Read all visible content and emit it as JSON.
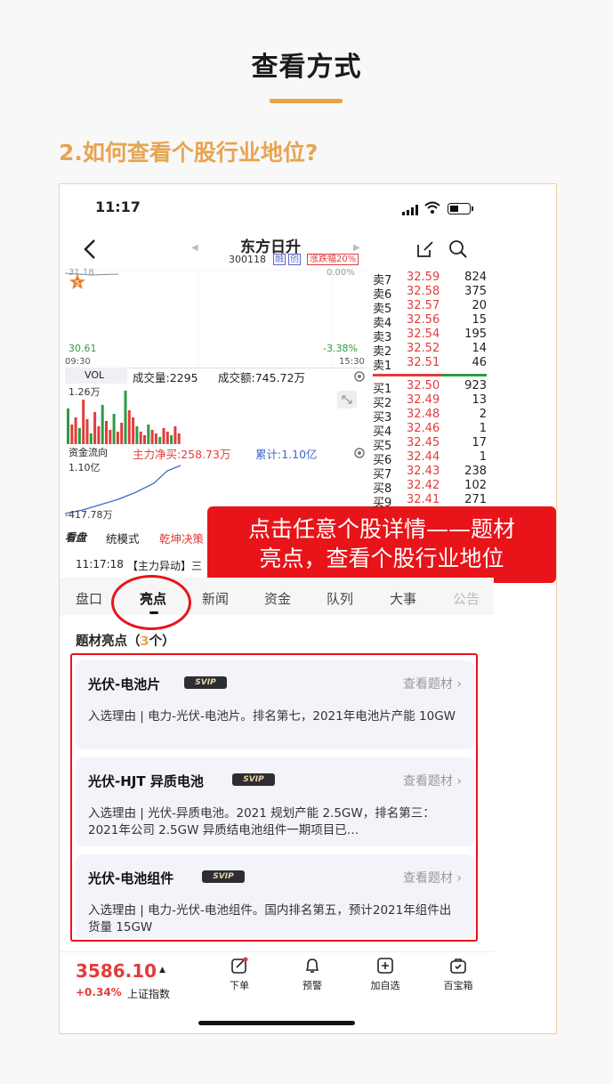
{
  "header": {
    "title": "查看方式",
    "section_heading": "2.如何查看个股行业地位?"
  },
  "status_bar": {
    "time": "11:17"
  },
  "stock_header": {
    "name": "东方日升",
    "code": "300118",
    "badge_rong": "融",
    "badge_chuang": "创",
    "limit_label": "涨跌幅20%"
  },
  "chart": {
    "top_left_value": "31.18",
    "top_right_value": "0.00%",
    "low_value": "30.61",
    "low_pct": "-3.38%",
    "time_start": "09:30",
    "time_end": "15:30",
    "vol_label": "VOL",
    "volume_text": "成交量:2295",
    "amount_text": "成交额:745.72万",
    "vol_axis_top": "1.26万",
    "fund_flow_label": "资金流向",
    "main_net_buy": "主力净买:258.73万",
    "cumulative": "累计:1.10亿",
    "fund_axis_top": "1.10亿",
    "fund_axis_bottom": "-417.78万"
  },
  "order_book": {
    "sell": [
      {
        "label": "卖7",
        "price": "32.59",
        "vol": "824"
      },
      {
        "label": "卖6",
        "price": "32.58",
        "vol": "375"
      },
      {
        "label": "卖5",
        "price": "32.57",
        "vol": "20"
      },
      {
        "label": "卖4",
        "price": "32.56",
        "vol": "15"
      },
      {
        "label": "卖3",
        "price": "32.54",
        "vol": "195"
      },
      {
        "label": "卖2",
        "price": "32.52",
        "vol": "14"
      },
      {
        "label": "卖1",
        "price": "32.51",
        "vol": "46"
      }
    ],
    "buy": [
      {
        "label": "买1",
        "price": "32.50",
        "vol": "923"
      },
      {
        "label": "买2",
        "price": "32.49",
        "vol": "13"
      },
      {
        "label": "买3",
        "price": "32.48",
        "vol": "2"
      },
      {
        "label": "买4",
        "price": "32.46",
        "vol": "1"
      },
      {
        "label": "买5",
        "price": "32.45",
        "vol": "17"
      },
      {
        "label": "买6",
        "price": "32.44",
        "vol": "1"
      },
      {
        "label": "买7",
        "price": "32.43",
        "vol": "238"
      },
      {
        "label": "买8",
        "price": "32.42",
        "vol": "102"
      },
      {
        "label": "买9",
        "price": "32.41",
        "vol": "271"
      }
    ]
  },
  "strip": {
    "kanpan": "看盘",
    "mode": "统模式",
    "decision": "乾坤决策"
  },
  "news_line": {
    "time": "11:17:18",
    "tag": "【主力异动】三"
  },
  "callout": {
    "line1": "点击任意个股详情——题材",
    "line2": "亮点，查看个股行业地位"
  },
  "tabs": [
    "盘口",
    "亮点",
    "新闻",
    "资金",
    "队列",
    "大事",
    "公告"
  ],
  "highlights": {
    "title_prefix": "题材亮点（",
    "count": "3",
    "title_suffix": "个）",
    "cards": [
      {
        "title": "光伏-电池片",
        "badge": "SVIP",
        "link": "查看题材 ›",
        "desc": "入选理由 | 电力-光伏-电池片。排名第七，2021年电池片产能 10GW"
      },
      {
        "title": "光伏-HJT 异质电池",
        "badge": "SVIP",
        "link": "查看题材 ›",
        "desc": "入选理由 | 光伏-异质电池。2021 规划产能 2.5GW，排名第三：2021年公司 2.5GW 异质结电池组件一期项目已…"
      },
      {
        "title": "光伏-电池组件",
        "badge": "SVIP",
        "link": "查看题材 ›",
        "desc": "入选理由 | 电力-光伏-电池组件。国内排名第五，预计2021年组件出货量 15GW"
      }
    ]
  },
  "bottom_bar": {
    "index_value": "3586.10",
    "index_change": "+0.34%",
    "index_name": "上证指数",
    "nav": [
      "下单",
      "预警",
      "加自选",
      "百宝箱"
    ]
  },
  "colors": {
    "accent": "#e8a450",
    "up": "#e23c3c",
    "down": "#2a9c43",
    "callout_bg": "#e8141a"
  }
}
